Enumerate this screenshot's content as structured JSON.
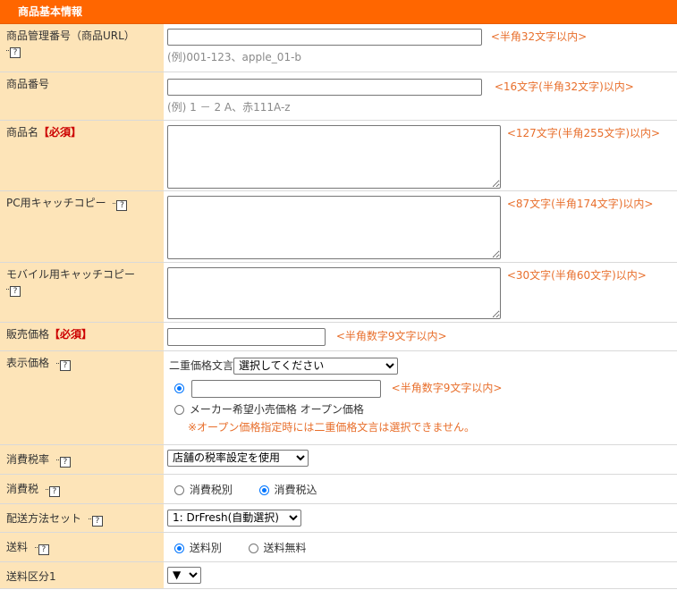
{
  "section_title": "商品基本情報",
  "help_glyph": "?",
  "rows": {
    "mgmt": {
      "label": "商品管理番号（商品URL）",
      "value": "",
      "hint": "<半角32文字以内>",
      "example": "(例)001-123、apple_01-b"
    },
    "number": {
      "label": "商品番号",
      "value": "",
      "hint": "<16文字(半角32文字)以内>",
      "example": "(例) 1 － 2 A、赤111A-z"
    },
    "name": {
      "label": "商品名",
      "required": "【必須】",
      "value": "",
      "hint": "<127文字(半角255文字)以内>"
    },
    "pc_catch": {
      "label": "PC用キャッチコピー",
      "value": "",
      "hint": "<87文字(半角174文字)以内>"
    },
    "mobile_catch": {
      "label": "モバイル用キャッチコピー",
      "value": "",
      "hint": "<30文字(半角60文字)以内>"
    },
    "price": {
      "label": "販売価格",
      "required": "【必須】",
      "value": "",
      "hint": "<半角数字9文字以内>"
    },
    "display_price": {
      "label": "表示価格",
      "double_label": "二重価格文言",
      "double_select": "選択してください",
      "price_value": "",
      "price_hint": "<半角数字9文字以内>",
      "open_price_label": "メーカー希望小売価格 オープン価格",
      "warning": "※オープン価格指定時には二重価格文言は選択できません。"
    },
    "tax_rate": {
      "label": "消費税率",
      "select": "店舗の税率設定を使用"
    },
    "tax": {
      "label": "消費税",
      "option1": "消費税別",
      "option2": "消費税込",
      "selected": "消費税込"
    },
    "shipping_set": {
      "label": "配送方法セット",
      "select": "1: DrFresh(自動選択)"
    },
    "shipping_fee": {
      "label": "送料",
      "option1": "送料別",
      "option2": "送料無料",
      "selected": "送料別"
    },
    "shipping_class": {
      "label": "送料区分1",
      "select": "▼"
    }
  },
  "colors": {
    "header_bg": "#ff6600",
    "label_bg": "#fde4b8",
    "hint": "#e86f2c",
    "required": "#cc0000",
    "radio_checked": "#0075ff"
  }
}
